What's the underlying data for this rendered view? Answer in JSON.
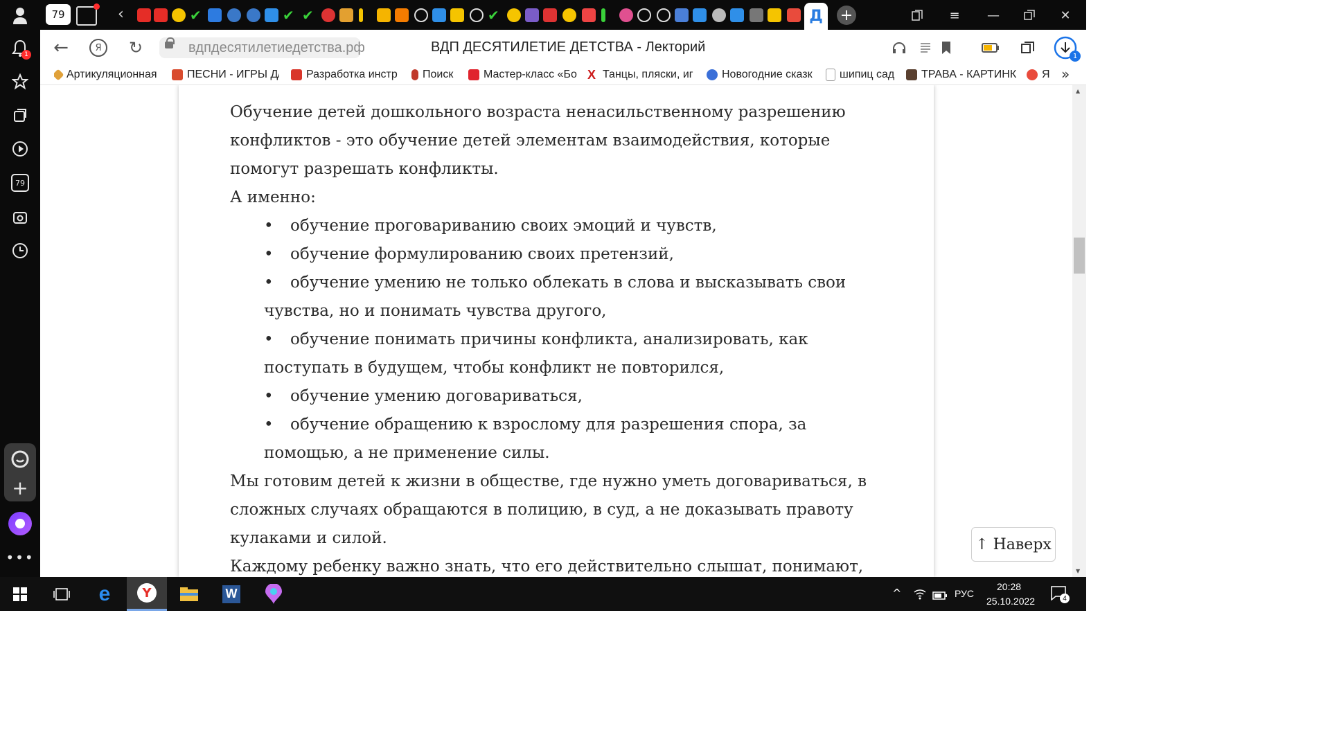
{
  "browser": {
    "tab_count": "79",
    "active_tab_glyph": "Д",
    "url": "вдпдесятилетиедетства.рф",
    "page_title": "ВДП ДЕСЯТИЛЕТИЕ ДЕТСТВА - Лекторий",
    "yandex_glyph": "Я",
    "downloads_badge": "1"
  },
  "sidebar": {
    "notifications_badge": "1",
    "tabs_counter": "79"
  },
  "bookmarks": [
    {
      "label": "Артикуляционная",
      "color": "#e0a13a"
    },
    {
      "label": "ПЕСНИ - ИГРЫ Д/",
      "color": "#d94c2f"
    },
    {
      "label": "Разработка инстр",
      "color": "#d9362b"
    },
    {
      "label": "Поиск",
      "color": "#c0392b"
    },
    {
      "label": "Мастер-класс «Бо",
      "color": "#e0242e"
    },
    {
      "label": "Танцы, пляски, иг",
      "color": "#cc1b1b"
    },
    {
      "label": "Новогодние сказк",
      "color": "#3a6fd8"
    },
    {
      "label": "шипиц сад",
      "color": "#9a9a9a"
    },
    {
      "label": "ТРАВА - КАРТИНК",
      "color": "#5a4030"
    },
    {
      "label": "Я",
      "color": "#e94b3c"
    }
  ],
  "article": {
    "para1_line1": "Обучение детей дошкольного возраста ненасильственному разрешению",
    "para1_line2": "конфликтов - это обучение детей элементам взаимодействия, которые",
    "para1_line3": "помогут разрешать конфликты.",
    "intro": "А именно:",
    "bullet_glyph": "•",
    "items": [
      {
        "line1": "обучение проговариванию своих эмоций и чувств,",
        "line2": ""
      },
      {
        "line1": "обучение формулированию своих претензий,",
        "line2": ""
      },
      {
        "line1": "обучение умению не только облекать в слова и высказывать свои",
        "line2": "чувства, но и понимать чувства другого,"
      },
      {
        "line1": "обучение понимать причины конфликта, анализировать, как",
        "line2": "поступать в будущем, чтобы конфликт не повторился,"
      },
      {
        "line1": "обучение умению договариваться,",
        "line2": ""
      },
      {
        "line1": "обучение обращению к взрослому для разрешения спора, за",
        "line2": "помощью, а не применение силы."
      }
    ],
    "para2_line1": "Мы готовим детей к жизни в обществе, где нужно уметь договариваться, в",
    "para2_line2": "сложных случаях обращаются в полицию, в суд, а не доказывать правоту",
    "para2_line3": "кулаками и силой.",
    "para3_line1": "Каждому ребенку важно знать, что его действительно слышат, понимают,"
  },
  "to_top_button": "↑ Наверх",
  "taskbar": {
    "lang": "РУС",
    "time": "20:28",
    "date": "25.10.2022",
    "notifications_count": "4"
  }
}
